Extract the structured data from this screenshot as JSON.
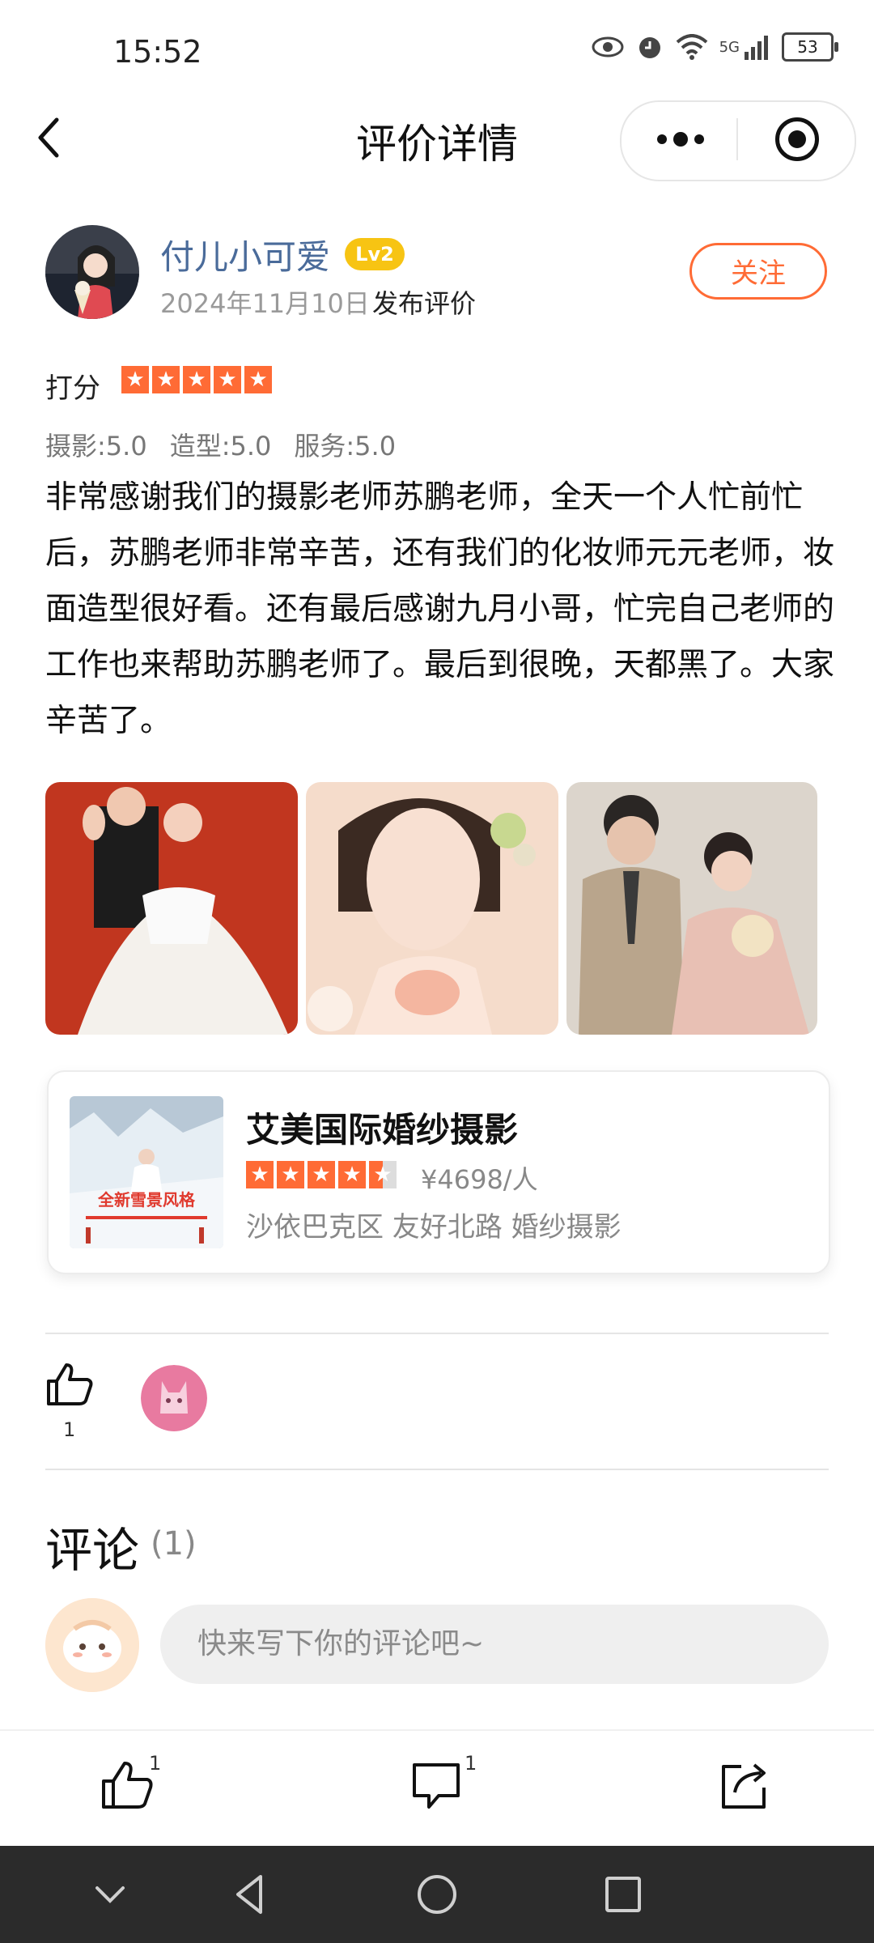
{
  "status_bar": {
    "time": "15:52",
    "network": "5G",
    "battery": "53"
  },
  "nav": {
    "title": "评价详情"
  },
  "review": {
    "user_name": "付儿小可爱",
    "level": "Lv2",
    "date": "2024年11月10日",
    "action": "发布评价",
    "follow_label": "关注",
    "rating_label": "打分",
    "rating": 5,
    "subscores": [
      "摄影:5.0",
      "造型:5.0",
      "服务:5.0"
    ],
    "text": "非常感谢我们的摄影老师苏鹏老师，全天一个人忙前忙后，苏鹏老师非常辛苦，还有我们的化妆师元元老师，妆面造型很好看。还有最后感谢九月小哥，忙完自己老师的工作也来帮助苏鹏老师了。最后到很晚，天都黑了。大家辛苦了。",
    "photo_count": 3
  },
  "merchant": {
    "name": "艾美国际婚纱摄影",
    "rating": 4.5,
    "price": "¥4698/人",
    "location": "沙依巴克区 友好北路 婚纱摄影",
    "thumb_caption": "全新雪景风格"
  },
  "likes": {
    "count": "1"
  },
  "comments": {
    "title": "评论",
    "count": "(1)",
    "input_placeholder": "快来写下你的评论吧~"
  },
  "bottom_bar": {
    "like_count": "1",
    "comment_count": "1"
  },
  "colors": {
    "accent": "#ff6b35",
    "username": "#4a6b9a",
    "level_badge": "#f7c413"
  }
}
